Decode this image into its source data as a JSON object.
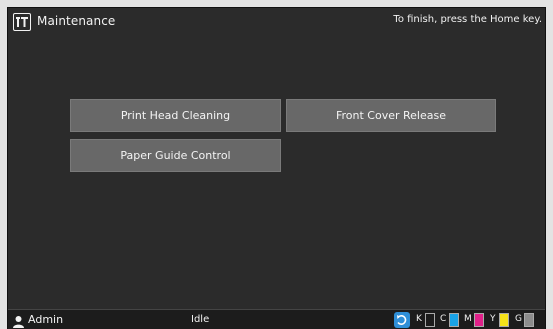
{
  "header": {
    "title": "Maintenance",
    "hint": "To finish, press the Home key."
  },
  "buttons": {
    "print_head_cleaning": "Print Head Cleaning",
    "front_cover_release": "Front Cover Release",
    "paper_guide_control": "Paper Guide Control"
  },
  "status": {
    "user": "Admin",
    "state": "Idle"
  },
  "inks": [
    {
      "label": "K",
      "color": "#1c1c1c"
    },
    {
      "label": "C",
      "color": "#1aa3e8"
    },
    {
      "label": "M",
      "color": "#e0218a"
    },
    {
      "label": "Y",
      "color": "#f5e21a"
    },
    {
      "label": "G",
      "color": "#8c8c8c"
    }
  ],
  "colors": {
    "screen_bg": "#2b2b2b",
    "button_bg": "#686868",
    "refresh_blue": "#2f8fd8"
  }
}
